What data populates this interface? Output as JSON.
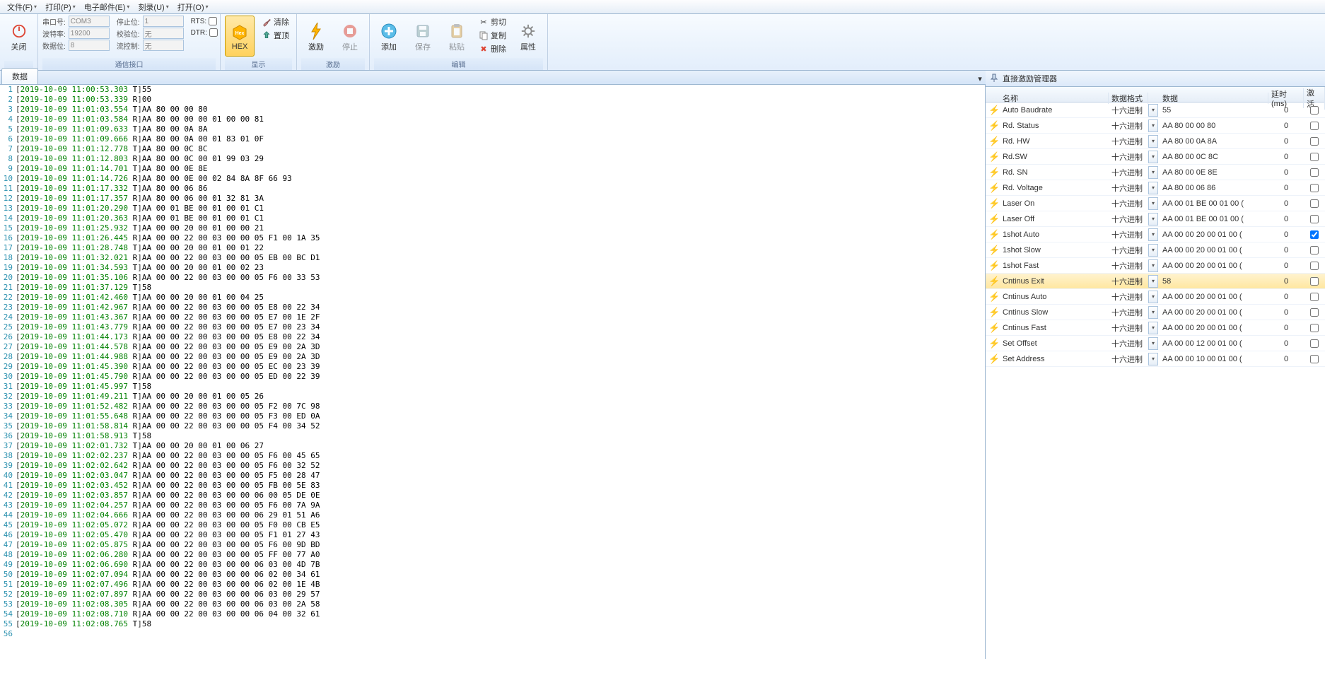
{
  "menu": [
    {
      "label": "文件(F)"
    },
    {
      "label": "打印(P)"
    },
    {
      "label": "电子邮件(E)"
    },
    {
      "label": "刻录(U)"
    },
    {
      "label": "打开(O)"
    }
  ],
  "ribbon": {
    "close": "关闭",
    "comm": {
      "port_label": "串口号:",
      "port": "COM3",
      "baud_label": "波特率:",
      "baud": "19200",
      "data_label": "数据位:",
      "data": "8",
      "stop_label": "停止位:",
      "stop": "1",
      "parity_label": "校验位:",
      "parity": "无",
      "flow_label": "流控制:",
      "flow": "无",
      "rts": "RTS:",
      "dtr": "DTR:",
      "group": "通信接口"
    },
    "display": {
      "hex": "HEX",
      "clear": "清除",
      "top": "置顶",
      "group": "显示"
    },
    "stimulate": {
      "go": "激励",
      "stop": "停止",
      "group": "激励"
    },
    "edit": {
      "add": "添加",
      "save": "保存",
      "paste": "粘贴",
      "cut": "剪切",
      "copy": "复制",
      "delete": "删除",
      "props": "属性",
      "group": "编辑"
    }
  },
  "tab_label": "数据",
  "log": [
    {
      "n": 1,
      "ts": "2019-10-09 11:00:53.303",
      "d": "T",
      "p": "55"
    },
    {
      "n": 2,
      "ts": "2019-10-09 11:00:53.339",
      "d": "R",
      "p": "00"
    },
    {
      "n": 3,
      "ts": "2019-10-09 11:01:03.554",
      "d": "T",
      "p": "AA 80 00 00 80"
    },
    {
      "n": 4,
      "ts": "2019-10-09 11:01:03.584",
      "d": "R",
      "p": "AA 80 00 00 00 01 00 00 81"
    },
    {
      "n": 5,
      "ts": "2019-10-09 11:01:09.633",
      "d": "T",
      "p": "AA 80 00 0A 8A"
    },
    {
      "n": 6,
      "ts": "2019-10-09 11:01:09.666",
      "d": "R",
      "p": "AA 80 00 0A 00 01 83 01 0F"
    },
    {
      "n": 7,
      "ts": "2019-10-09 11:01:12.778",
      "d": "T",
      "p": "AA 80 00 0C 8C"
    },
    {
      "n": 8,
      "ts": "2019-10-09 11:01:12.803",
      "d": "R",
      "p": "AA 80 00 0C 00 01 99 03 29"
    },
    {
      "n": 9,
      "ts": "2019-10-09 11:01:14.701",
      "d": "T",
      "p": "AA 80 00 0E 8E"
    },
    {
      "n": 10,
      "ts": "2019-10-09 11:01:14.726",
      "d": "R",
      "p": "AA 80 00 0E 00 02 84 8A 8F 66 93"
    },
    {
      "n": 11,
      "ts": "2019-10-09 11:01:17.332",
      "d": "T",
      "p": "AA 80 00 06 86"
    },
    {
      "n": 12,
      "ts": "2019-10-09 11:01:17.357",
      "d": "R",
      "p": "AA 80 00 06 00 01 32 81 3A"
    },
    {
      "n": 13,
      "ts": "2019-10-09 11:01:20.290",
      "d": "T",
      "p": "AA 00 01 BE 00 01 00 01 C1"
    },
    {
      "n": 14,
      "ts": "2019-10-09 11:01:20.363",
      "d": "R",
      "p": "AA 00 01 BE 00 01 00 01 C1"
    },
    {
      "n": 15,
      "ts": "2019-10-09 11:01:25.932",
      "d": "T",
      "p": "AA 00 00 20 00 01 00 00 21"
    },
    {
      "n": 16,
      "ts": "2019-10-09 11:01:26.445",
      "d": "R",
      "p": "AA 00 00 22 00 03 00 00 05 F1 00 1A 35"
    },
    {
      "n": 17,
      "ts": "2019-10-09 11:01:28.748",
      "d": "T",
      "p": "AA 00 00 20 00 01 00 01 22"
    },
    {
      "n": 18,
      "ts": "2019-10-09 11:01:32.021",
      "d": "R",
      "p": "AA 00 00 22 00 03 00 00 05 EB 00 BC D1"
    },
    {
      "n": 19,
      "ts": "2019-10-09 11:01:34.593",
      "d": "T",
      "p": "AA 00 00 20 00 01 00 02 23"
    },
    {
      "n": 20,
      "ts": "2019-10-09 11:01:35.106",
      "d": "R",
      "p": "AA 00 00 22 00 03 00 00 05 F6 00 33 53"
    },
    {
      "n": 21,
      "ts": "2019-10-09 11:01:37.129",
      "d": "T",
      "p": "58"
    },
    {
      "n": 22,
      "ts": "2019-10-09 11:01:42.460",
      "d": "T",
      "p": "AA 00 00 20 00 01 00 04 25"
    },
    {
      "n": 23,
      "ts": "2019-10-09 11:01:42.967",
      "d": "R",
      "p": "AA 00 00 22 00 03 00 00 05 E8 00 22 34"
    },
    {
      "n": 24,
      "ts": "2019-10-09 11:01:43.367",
      "d": "R",
      "p": "AA 00 00 22 00 03 00 00 05 E7 00 1E 2F"
    },
    {
      "n": 25,
      "ts": "2019-10-09 11:01:43.779",
      "d": "R",
      "p": "AA 00 00 22 00 03 00 00 05 E7 00 23 34"
    },
    {
      "n": 26,
      "ts": "2019-10-09 11:01:44.173",
      "d": "R",
      "p": "AA 00 00 22 00 03 00 00 05 E8 00 22 34"
    },
    {
      "n": 27,
      "ts": "2019-10-09 11:01:44.578",
      "d": "R",
      "p": "AA 00 00 22 00 03 00 00 05 E9 00 2A 3D"
    },
    {
      "n": 28,
      "ts": "2019-10-09 11:01:44.988",
      "d": "R",
      "p": "AA 00 00 22 00 03 00 00 05 E9 00 2A 3D"
    },
    {
      "n": 29,
      "ts": "2019-10-09 11:01:45.390",
      "d": "R",
      "p": "AA 00 00 22 00 03 00 00 05 EC 00 23 39"
    },
    {
      "n": 30,
      "ts": "2019-10-09 11:01:45.790",
      "d": "R",
      "p": "AA 00 00 22 00 03 00 00 05 ED 00 22 39"
    },
    {
      "n": 31,
      "ts": "2019-10-09 11:01:45.997",
      "d": "T",
      "p": "58"
    },
    {
      "n": 32,
      "ts": "2019-10-09 11:01:49.211",
      "d": "T",
      "p": "AA 00 00 20 00 01 00 05 26"
    },
    {
      "n": 33,
      "ts": "2019-10-09 11:01:52.482",
      "d": "R",
      "p": "AA 00 00 22 00 03 00 00 05 F2 00 7C 98"
    },
    {
      "n": 34,
      "ts": "2019-10-09 11:01:55.648",
      "d": "R",
      "p": "AA 00 00 22 00 03 00 00 05 F3 00 ED 0A"
    },
    {
      "n": 35,
      "ts": "2019-10-09 11:01:58.814",
      "d": "R",
      "p": "AA 00 00 22 00 03 00 00 05 F4 00 34 52"
    },
    {
      "n": 36,
      "ts": "2019-10-09 11:01:58.913",
      "d": "T",
      "p": "58"
    },
    {
      "n": 37,
      "ts": "2019-10-09 11:02:01.732",
      "d": "T",
      "p": "AA 00 00 20 00 01 00 06 27"
    },
    {
      "n": 38,
      "ts": "2019-10-09 11:02:02.237",
      "d": "R",
      "p": "AA 00 00 22 00 03 00 00 05 F6 00 45 65"
    },
    {
      "n": 39,
      "ts": "2019-10-09 11:02:02.642",
      "d": "R",
      "p": "AA 00 00 22 00 03 00 00 05 F6 00 32 52"
    },
    {
      "n": 40,
      "ts": "2019-10-09 11:02:03.047",
      "d": "R",
      "p": "AA 00 00 22 00 03 00 00 05 F5 00 28 47"
    },
    {
      "n": 41,
      "ts": "2019-10-09 11:02:03.452",
      "d": "R",
      "p": "AA 00 00 22 00 03 00 00 05 FB 00 5E 83"
    },
    {
      "n": 42,
      "ts": "2019-10-09 11:02:03.857",
      "d": "R",
      "p": "AA 00 00 22 00 03 00 00 06 00 05 DE 0E"
    },
    {
      "n": 43,
      "ts": "2019-10-09 11:02:04.257",
      "d": "R",
      "p": "AA 00 00 22 00 03 00 00 05 F6 00 7A 9A"
    },
    {
      "n": 44,
      "ts": "2019-10-09 11:02:04.666",
      "d": "R",
      "p": "AA 00 00 22 00 03 00 00 06 29 01 51 A6"
    },
    {
      "n": 45,
      "ts": "2019-10-09 11:02:05.072",
      "d": "R",
      "p": "AA 00 00 22 00 03 00 00 05 F0 00 CB E5"
    },
    {
      "n": 46,
      "ts": "2019-10-09 11:02:05.470",
      "d": "R",
      "p": "AA 00 00 22 00 03 00 00 05 F1 01 27 43"
    },
    {
      "n": 47,
      "ts": "2019-10-09 11:02:05.875",
      "d": "R",
      "p": "AA 00 00 22 00 03 00 00 05 F6 00 9D BD"
    },
    {
      "n": 48,
      "ts": "2019-10-09 11:02:06.280",
      "d": "R",
      "p": "AA 00 00 22 00 03 00 00 05 FF 00 77 A0"
    },
    {
      "n": 49,
      "ts": "2019-10-09 11:02:06.690",
      "d": "R",
      "p": "AA 00 00 22 00 03 00 00 06 03 00 4D 7B"
    },
    {
      "n": 50,
      "ts": "2019-10-09 11:02:07.094",
      "d": "R",
      "p": "AA 00 00 22 00 03 00 00 06 02 00 34 61"
    },
    {
      "n": 51,
      "ts": "2019-10-09 11:02:07.496",
      "d": "R",
      "p": "AA 00 00 22 00 03 00 00 06 02 00 1E 4B"
    },
    {
      "n": 52,
      "ts": "2019-10-09 11:02:07.897",
      "d": "R",
      "p": "AA 00 00 22 00 03 00 00 06 03 00 29 57"
    },
    {
      "n": 53,
      "ts": "2019-10-09 11:02:08.305",
      "d": "R",
      "p": "AA 00 00 22 00 03 00 00 06 03 00 2A 58"
    },
    {
      "n": 54,
      "ts": "2019-10-09 11:02:08.710",
      "d": "R",
      "p": "AA 00 00 22 00 03 00 00 06 04 00 32 61"
    },
    {
      "n": 55,
      "ts": "2019-10-09 11:02:08.765",
      "d": "T",
      "p": "58"
    }
  ],
  "side": {
    "title": "直接激励管理器",
    "cols": {
      "name": "名称",
      "fmt": "数据格式",
      "data": "数据",
      "delay": "延时(ms)",
      "active": "激活"
    },
    "rows": [
      {
        "name": "Auto Baudrate",
        "fmt": "十六进制",
        "data": "55",
        "delay": "0",
        "active": false
      },
      {
        "name": "Rd. Status",
        "fmt": "十六进制",
        "data": "AA 80 00 00 80",
        "delay": "0",
        "active": false
      },
      {
        "name": "Rd. HW",
        "fmt": "十六进制",
        "data": "AA 80 00 0A 8A",
        "delay": "0",
        "active": false
      },
      {
        "name": "Rd.SW",
        "fmt": "十六进制",
        "data": "AA 80 00 0C 8C",
        "delay": "0",
        "active": false
      },
      {
        "name": "Rd. SN",
        "fmt": "十六进制",
        "data": "AA 80 00 0E 8E",
        "delay": "0",
        "active": false
      },
      {
        "name": "Rd. Voltage",
        "fmt": "十六进制",
        "data": "AA 80 00 06 86",
        "delay": "0",
        "active": false
      },
      {
        "name": "Laser On",
        "fmt": "十六进制",
        "data": "AA 00 01 BE 00 01 00 (",
        "delay": "0",
        "active": false
      },
      {
        "name": "Laser Off",
        "fmt": "十六进制",
        "data": "AA 00 01 BE 00 01 00 (",
        "delay": "0",
        "active": false
      },
      {
        "name": "1shot Auto",
        "fmt": "十六进制",
        "data": "AA 00 00 20 00 01 00 (",
        "delay": "0",
        "active": true
      },
      {
        "name": "1shot Slow",
        "fmt": "十六进制",
        "data": "AA 00 00 20 00 01 00 (",
        "delay": "0",
        "active": false
      },
      {
        "name": "1shot Fast",
        "fmt": "十六进制",
        "data": "AA 00 00 20 00 01 00 (",
        "delay": "0",
        "active": false
      },
      {
        "name": "Cntinus Exit",
        "fmt": "十六进制",
        "data": "58",
        "delay": "0",
        "active": false,
        "selected": true
      },
      {
        "name": "Cntinus Auto",
        "fmt": "十六进制",
        "data": "AA 00 00 20 00 01 00 (",
        "delay": "0",
        "active": false
      },
      {
        "name": "Cntinus Slow",
        "fmt": "十六进制",
        "data": "AA 00 00 20 00 01 00 (",
        "delay": "0",
        "active": false
      },
      {
        "name": "Cntinus Fast",
        "fmt": "十六进制",
        "data": "AA 00 00 20 00 01 00 (",
        "delay": "0",
        "active": false
      },
      {
        "name": "Set Offset",
        "fmt": "十六进制",
        "data": "AA 00 00 12 00 01 00 (",
        "delay": "0",
        "active": false
      },
      {
        "name": "Set Address",
        "fmt": "十六进制",
        "data": "AA 00 00 10 00 01 00 (",
        "delay": "0",
        "active": false
      }
    ]
  }
}
